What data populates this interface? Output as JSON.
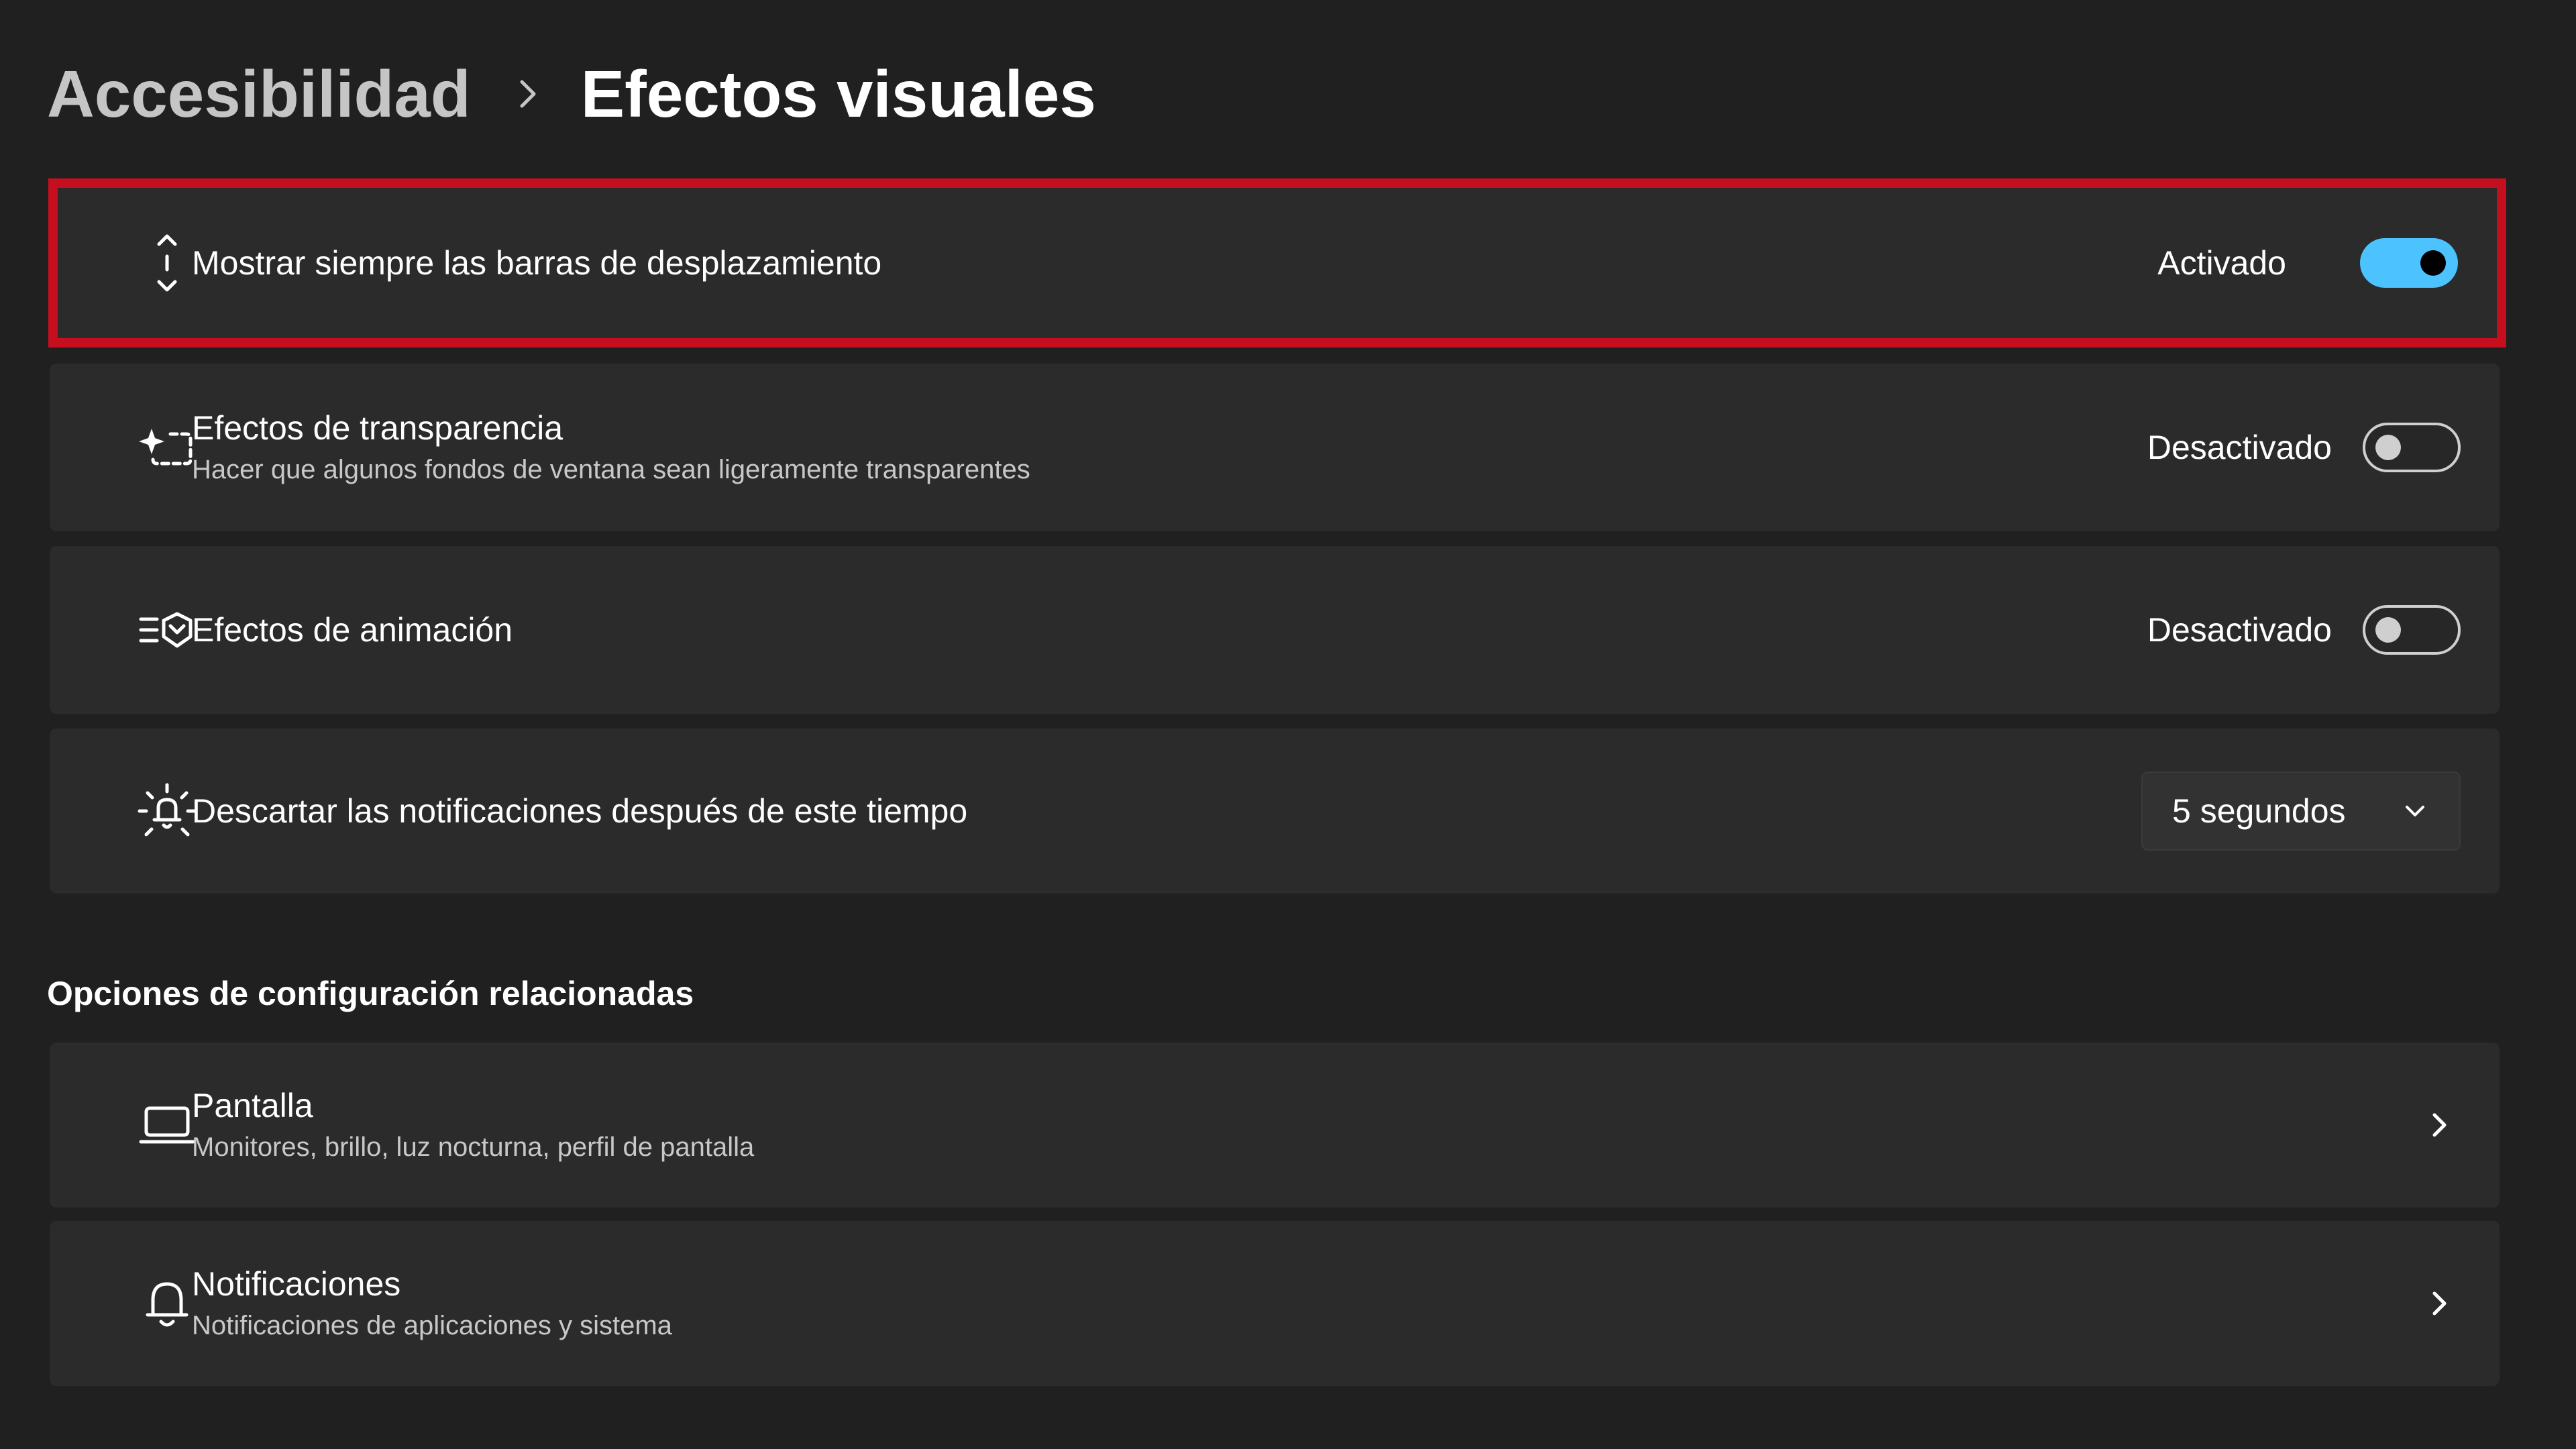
{
  "breadcrumb": {
    "parent": "Accesibilidad",
    "current": "Efectos visuales"
  },
  "settings": [
    {
      "icon": "scrollbar-arrows-icon",
      "title": "Mostrar siempre las barras de desplazamiento",
      "state_label": "Activado",
      "toggle_on": true,
      "highlighted": true
    },
    {
      "icon": "transparency-sparkle-icon",
      "title": "Efectos de transparencia",
      "subtitle": "Hacer que algunos fondos de ventana sean ligeramente transparentes",
      "state_label": "Desactivado",
      "toggle_on": false
    },
    {
      "icon": "animation-effects-icon",
      "title": "Efectos de animación",
      "state_label": "Desactivado",
      "toggle_on": false
    },
    {
      "icon": "notification-bell-sun-icon",
      "title": "Descartar las notificaciones después de este tiempo",
      "dropdown_value": "5 segundos"
    }
  ],
  "related": {
    "title": "Opciones de configuración relacionadas",
    "items": [
      {
        "icon": "laptop-display-icon",
        "title": "Pantalla",
        "subtitle": "Monitores, brillo, luz nocturna, perfil de pantalla"
      },
      {
        "icon": "bell-icon",
        "title": "Notificaciones",
        "subtitle": "Notificaciones de aplicaciones y sistema"
      }
    ]
  },
  "colors": {
    "background": "#202020",
    "card": "#2b2b2b",
    "accent": "#4cc2ff",
    "highlight_border": "#c50f1f"
  }
}
